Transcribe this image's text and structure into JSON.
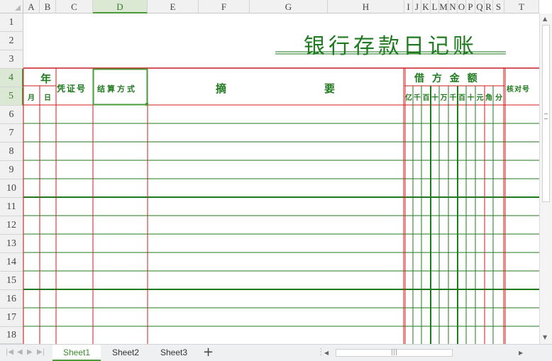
{
  "columns": [
    "A",
    "B",
    "C",
    "D",
    "E",
    "F",
    "G",
    "H",
    "I",
    "J",
    "K",
    "L",
    "M",
    "N",
    "O",
    "P",
    "Q",
    "R",
    "S",
    "T"
  ],
  "selected_column": "D",
  "rows": [
    "1",
    "2",
    "3",
    "4",
    "5",
    "6",
    "7",
    "8",
    "9",
    "10",
    "11",
    "12",
    "13",
    "14",
    "15",
    "16",
    "17",
    "18"
  ],
  "selected_rows": [
    "4",
    "5"
  ],
  "ledger": {
    "title": "银行存款日记账",
    "year_label": "年",
    "month_label": "月",
    "day_label": "日",
    "voucher_label": "凭证号",
    "settlement_label": "结算方式",
    "summary_left": "摘",
    "summary_right": "要",
    "debit_amount_label": "借 方 金 额",
    "amount_digits": [
      "亿",
      "千",
      "百",
      "十",
      "万",
      "千",
      "百",
      "十",
      "元",
      "角",
      "分"
    ],
    "check_label": "核对号"
  },
  "colors": {
    "ledger_text": "#1f7a1f",
    "red_line": "#cc1e1e",
    "green_line": "#1f7a1f",
    "selection": "#4a9a3a"
  },
  "sheets": [
    {
      "name": "Sheet1",
      "active": true
    },
    {
      "name": "Sheet2",
      "active": false
    },
    {
      "name": "Sheet3",
      "active": false
    }
  ],
  "icons": {
    "add_sheet": "plus-icon",
    "nav": [
      "first-sheet-icon",
      "prev-sheet-icon",
      "next-sheet-icon",
      "last-sheet-icon"
    ]
  }
}
